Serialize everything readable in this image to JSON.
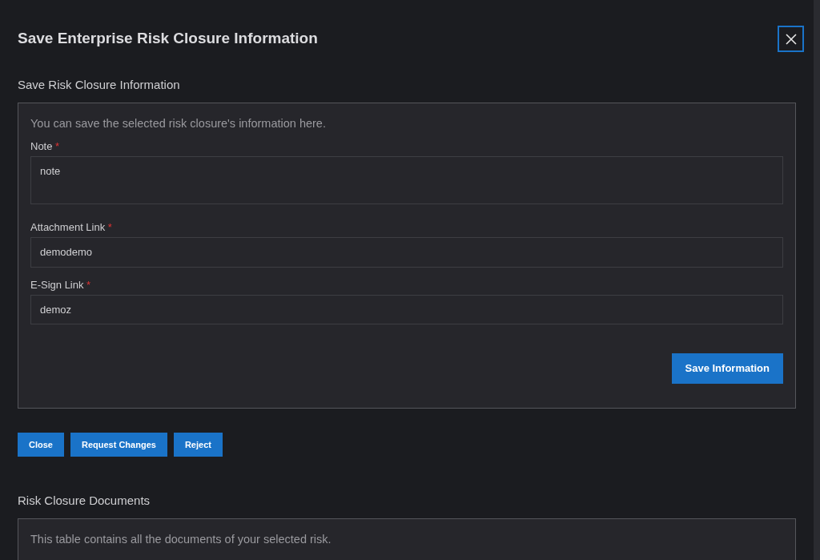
{
  "dialog": {
    "title": "Save Enterprise Risk Closure Information"
  },
  "info_section": {
    "heading": "Save Risk Closure Information",
    "description": "You can save the selected risk closure's information here.",
    "fields": [
      {
        "kind": "textarea",
        "label": "Note",
        "required_mark": "*",
        "value": "note"
      },
      {
        "kind": "input",
        "label": "Attachment Link",
        "required_mark": "*",
        "value": "demodemo"
      },
      {
        "kind": "input",
        "label": "E-Sign Link",
        "required_mark": "*",
        "value": "demoz"
      }
    ],
    "save_button": "Save Information"
  },
  "actions": [
    "Close",
    "Request Changes",
    "Reject"
  ],
  "documents_section": {
    "heading": "Risk Closure Documents",
    "description": "This table contains all the documents of your selected risk."
  }
}
